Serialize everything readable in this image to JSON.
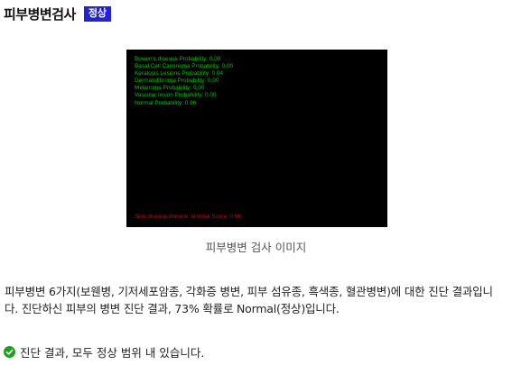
{
  "header": {
    "title": "피부병변검사",
    "status_badge": "정상",
    "badge_color": "#2222dd"
  },
  "result_image": {
    "probabilities": [
      "Bowen's disease Probability: 0.00",
      "Basal Cell Carcinoma Probability: 0.00",
      "Keratosis Lesions Probability: 0.04",
      "Dermatofibroma Probability: 0.00",
      "Melanoma Probability: 0.00",
      "Vascular lesion Probability: 0.00",
      "Normal Probability: 0.96"
    ],
    "division_text": "Skin disease division: Normal Score: 0.96",
    "text_color_probabilities": "#00c800",
    "text_color_division": "#e00000"
  },
  "caption": "피부병변 검사 이미지",
  "description": "피부병변 6가지(보웬병, 기저세포암종, 각화증 병변, 피부 섬유종, 흑색종, 혈관병변)에 대한 진단 결과입니다. 진단하신 피부의 병변 진단 결과, 73% 확률로 Normal(정상)입니다.",
  "conclusion": {
    "icon": "check-circle-icon",
    "text": "진단 결과, 모두 정상 범위 내 있습니다.",
    "icon_color": "#1aa01a"
  }
}
